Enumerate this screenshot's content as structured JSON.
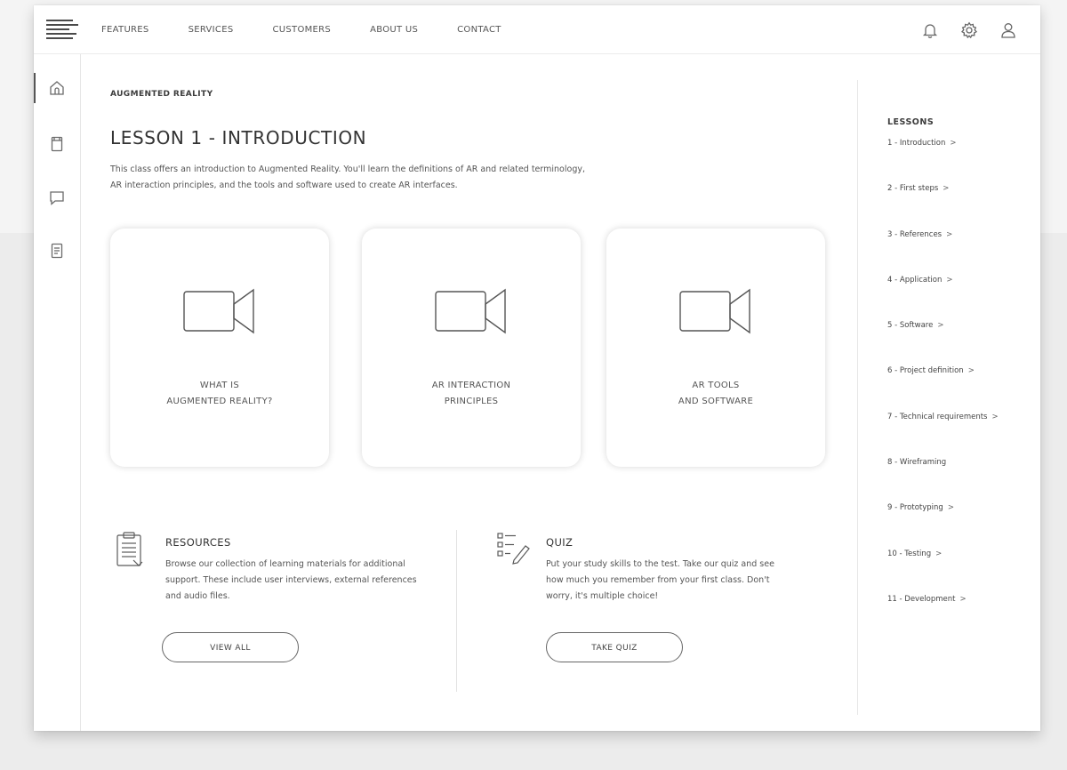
{
  "nav": {
    "links": [
      "FEATURES",
      "SERVICES",
      "CUSTOMERS",
      "ABOUT US",
      "CONTACT"
    ]
  },
  "top_icons": [
    "bell-icon",
    "gear-icon",
    "user-icon"
  ],
  "rail": {
    "icons": [
      "home-icon",
      "notebook-icon",
      "chat-icon",
      "document-icon"
    ],
    "active": "home-icon"
  },
  "main": {
    "breadcrumb": "AUGMENTED REALITY",
    "title": "LESSON 1 - INTRODUCTION",
    "description": [
      "This class offers an introduction to Augmented Reality. You'll learn the definitions of AR and related terminology,",
      "AR interaction principles, and the tools and software used to create AR interfaces."
    ],
    "videos": [
      {
        "icon": "video-camera-icon",
        "caption": [
          "WHAT IS",
          "AUGMENTED REALITY?"
        ]
      },
      {
        "icon": "video-camera-icon",
        "caption": [
          "AR INTERACTION",
          "PRINCIPLES"
        ]
      },
      {
        "icon": "video-camera-icon",
        "caption": [
          "AR TOOLS",
          "AND SOFTWARE"
        ]
      }
    ],
    "resources": {
      "icon": "clipboard-document-icon",
      "title": "RESOURCES",
      "text": [
        "Browse our collection of learning materials for additional",
        "support. These include user interviews, external references",
        "and audio files."
      ],
      "button": "VIEW ALL"
    },
    "quiz": {
      "icon": "checklist-pencil-icon",
      "title": "QUIZ",
      "text": [
        "Put your study skills to the test. Take our quiz and see",
        "how much you remember from your first class. Don't",
        "worry, it's multiple choice!"
      ],
      "button": "TAKE QUIZ"
    }
  },
  "lessons": {
    "title": "LESSONS",
    "items": [
      {
        "label": "1 - Introduction",
        "chevron": ">"
      },
      {
        "label": "2 - First steps",
        "chevron": ">"
      },
      {
        "label": "3 - References",
        "chevron": ">"
      },
      {
        "label": "4 - Application",
        "chevron": ">"
      },
      {
        "label": "5 - Software",
        "chevron": ">"
      },
      {
        "label": "6 - Project definition",
        "chevron": ">"
      },
      {
        "label": "7 - Technical requirements",
        "chevron": ">"
      },
      {
        "label": "8 - Wireframing",
        "chevron": ""
      },
      {
        "label": "9 - Prototyping",
        "chevron": ">"
      },
      {
        "label": "10 - Testing",
        "chevron": ">"
      },
      {
        "label": "11 - Development",
        "chevron": ">"
      }
    ]
  }
}
